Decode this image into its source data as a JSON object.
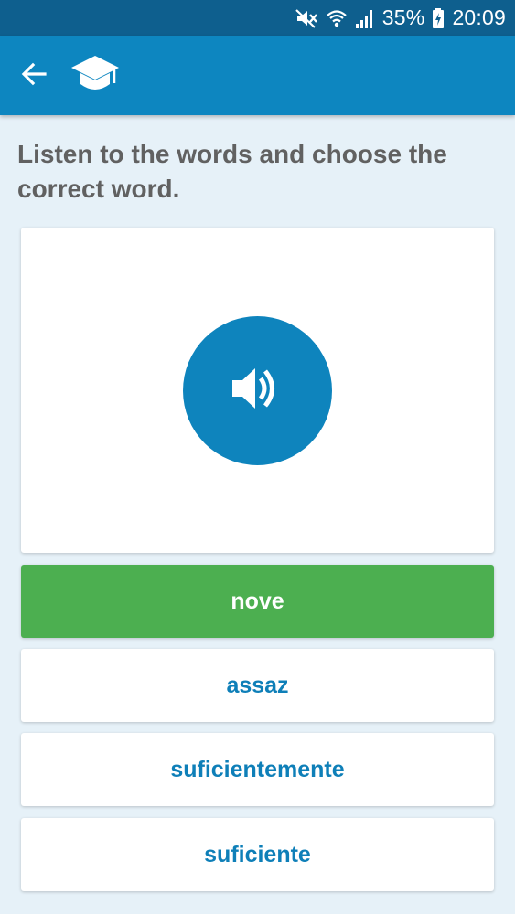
{
  "status_bar": {
    "battery": "35%",
    "time": "20:09",
    "icons": [
      "mute-icon",
      "wifi-icon",
      "signal-icon",
      "battery-charging-icon"
    ]
  },
  "app_bar": {
    "back_icon": "arrow-left-icon",
    "app_icon": "graduation-cap-icon",
    "color": "#0d86c0"
  },
  "quiz": {
    "instruction": "Listen to the words and choose the correct word.",
    "play_icon": "speaker-icon",
    "options": [
      {
        "label": "nove",
        "state": "correct"
      },
      {
        "label": "assaz",
        "state": "default"
      },
      {
        "label": "suficientemente",
        "state": "default"
      },
      {
        "label": "suficiente",
        "state": "default"
      }
    ]
  },
  "colors": {
    "accent": "#0e84bd",
    "correct": "#4caf50",
    "background": "#e6f1f8"
  }
}
